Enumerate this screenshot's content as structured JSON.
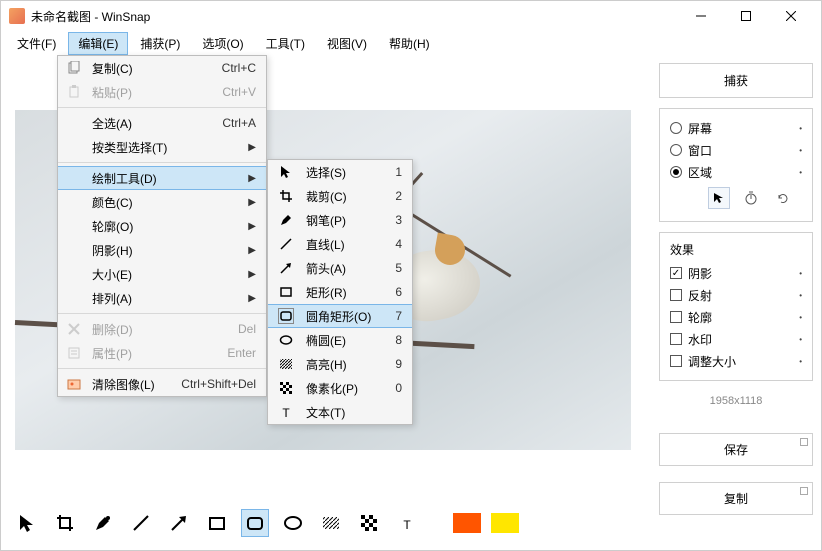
{
  "window": {
    "title": "未命名截图 - WinSnap"
  },
  "menubar": [
    "文件(F)",
    "编辑(E)",
    "捕获(P)",
    "选项(O)",
    "工具(T)",
    "视图(V)",
    "帮助(H)"
  ],
  "editMenu": {
    "copy": "复制(C)",
    "copyAccel": "Ctrl+C",
    "paste": "粘贴(P)",
    "pasteAccel": "Ctrl+V",
    "selectAll": "全选(A)",
    "selectAllAccel": "Ctrl+A",
    "byType": "按类型选择(T)",
    "drawTools": "绘制工具(D)",
    "color": "颜色(C)",
    "outline": "轮廓(O)",
    "shadow": "阴影(H)",
    "size": "大小(E)",
    "arrange": "排列(A)",
    "delete": "删除(D)",
    "deleteAccel": "Del",
    "props": "属性(P)",
    "propsAccel": "Enter",
    "clear": "清除图像(L)",
    "clearAccel": "Ctrl+Shift+Del"
  },
  "drawSubmenu": [
    {
      "label": "选择(S)",
      "key": "1",
      "icon": "cursor"
    },
    {
      "label": "裁剪(C)",
      "key": "2",
      "icon": "crop"
    },
    {
      "label": "钢笔(P)",
      "key": "3",
      "icon": "pen"
    },
    {
      "label": "直线(L)",
      "key": "4",
      "icon": "line"
    },
    {
      "label": "箭头(A)",
      "key": "5",
      "icon": "arrow"
    },
    {
      "label": "矩形(R)",
      "key": "6",
      "icon": "rect"
    },
    {
      "label": "圆角矩形(O)",
      "key": "7",
      "icon": "roundrect",
      "hl": true
    },
    {
      "label": "椭圆(E)",
      "key": "8",
      "icon": "ellipse"
    },
    {
      "label": "高亮(H)",
      "key": "9",
      "icon": "highlight"
    },
    {
      "label": "像素化(P)",
      "key": "0",
      "icon": "pixelate"
    },
    {
      "label": "文本(T)",
      "key": "",
      "icon": "text"
    }
  ],
  "sidebar": {
    "captureBtn": "捕获",
    "modes": [
      {
        "label": "屏幕",
        "selected": false
      },
      {
        "label": "窗口",
        "selected": false
      },
      {
        "label": "区域",
        "selected": true
      }
    ],
    "effectsTitle": "效果",
    "effects": [
      {
        "label": "阴影",
        "checked": true
      },
      {
        "label": "反射",
        "checked": false
      },
      {
        "label": "轮廓",
        "checked": false
      },
      {
        "label": "水印",
        "checked": false
      },
      {
        "label": "调整大小",
        "checked": false
      }
    ],
    "dims": "1958x1118",
    "save": "保存",
    "copy": "复制"
  },
  "colors": {
    "primary": "#ff5500",
    "secondary": "#ffe600",
    "shadow": "#6b6b6b"
  }
}
